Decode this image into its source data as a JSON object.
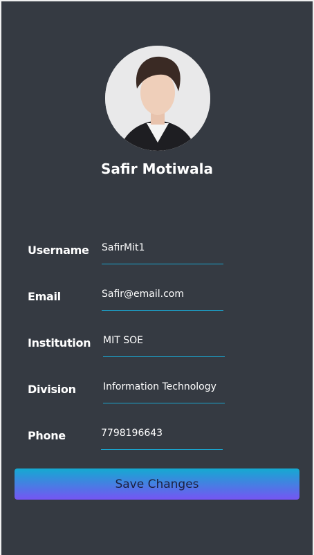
{
  "profile": {
    "name": "Safir Motiwala"
  },
  "fields": [
    {
      "label": "Username",
      "value": "SafirMit1"
    },
    {
      "label": "Email",
      "value": "Safir@email.com"
    },
    {
      "label": "Institution",
      "value": "MIT SOE"
    },
    {
      "label": "Division",
      "value": "Information Technology"
    },
    {
      "label": "Phone",
      "value": "7798196643"
    }
  ],
  "save_label": "Save Changes",
  "colors": {
    "background": "#353a42",
    "accent": "#1aa6d0",
    "button_top": "#14aad1",
    "button_bottom": "#7655f3"
  }
}
